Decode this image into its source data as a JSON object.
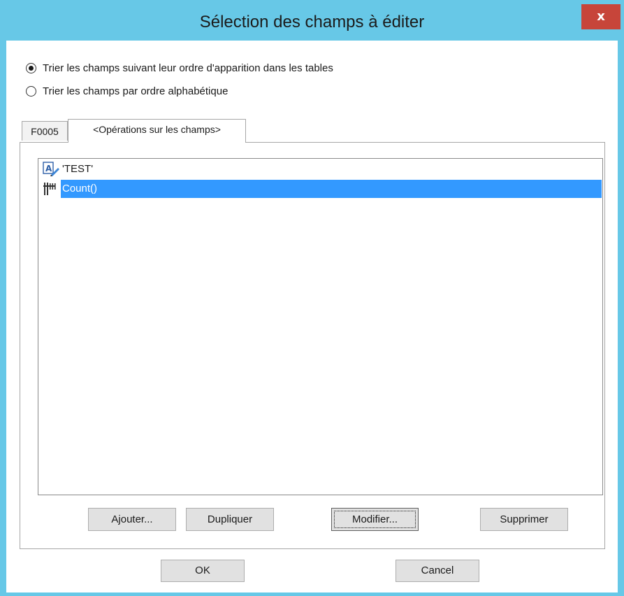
{
  "window": {
    "title": "Sélection des champs à éditer",
    "close_label": "x",
    "titlebar_color": "#67c8e7",
    "close_color": "#c7453a"
  },
  "sort_options": [
    {
      "label": "Trier les champs suivant leur ordre d'apparition dans les tables",
      "checked": true
    },
    {
      "label": "Trier les champs par ordre alphabétique",
      "checked": false
    }
  ],
  "tabs": [
    {
      "label": "F0005",
      "active": false
    },
    {
      "label": "<Opérations sur les champs>",
      "active": true
    }
  ],
  "field_list": {
    "items": [
      {
        "label": "'TEST'",
        "icon": "text-field-icon",
        "selected": false
      },
      {
        "label": "Count()",
        "icon": "numeric-field-icon",
        "selected": true
      }
    ],
    "selection_color": "#3399ff"
  },
  "actions": {
    "add": "Ajouter...",
    "duplicate": "Dupliquer",
    "modify": "Modifier...",
    "delete": "Supprimer"
  },
  "footer": {
    "ok": "OK",
    "cancel": "Cancel"
  }
}
